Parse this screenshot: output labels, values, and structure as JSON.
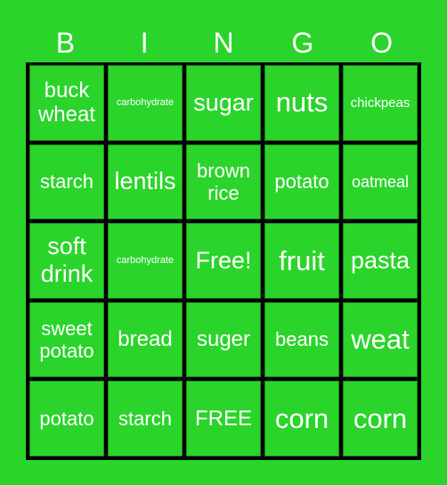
{
  "header": [
    "B",
    "I",
    "N",
    "G",
    "O"
  ],
  "grid": [
    [
      "buck wheat",
      "carbohydrate",
      "sugar",
      "nuts",
      "chickpeas"
    ],
    [
      "starch",
      "lentils",
      "brown rice",
      "potato",
      "oatmeal"
    ],
    [
      "soft drink",
      "carbohydrate",
      "Free!",
      "fruit",
      "pasta"
    ],
    [
      "sweet potato",
      "bread",
      "suger",
      "beans",
      "weat"
    ],
    [
      "potato",
      "starch",
      "FREE",
      "corn",
      "corn"
    ]
  ],
  "colors": {
    "background": "#2bd42b",
    "grid_lines": "#000000",
    "text": "#ffffff"
  }
}
